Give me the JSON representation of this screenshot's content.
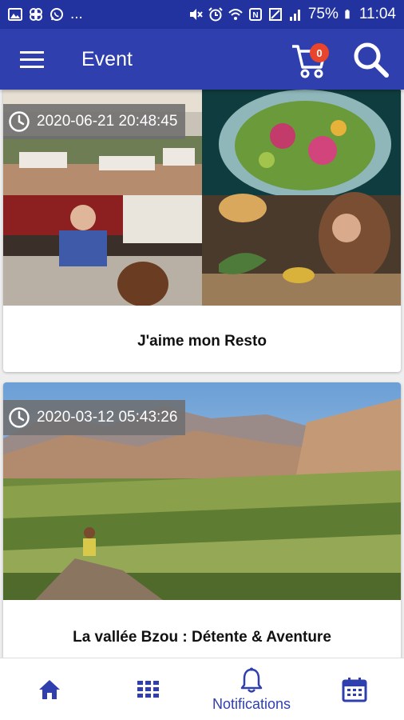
{
  "status_bar": {
    "battery": "75%",
    "time": "11:04",
    "left_icons": [
      "gallery-icon",
      "pinwheel-icon",
      "whatsapp-icon"
    ],
    "ellipsis": "..."
  },
  "app_bar": {
    "title": "Event",
    "cart_count": "0",
    "accent": "#2f3fae"
  },
  "events": [
    {
      "date": "2020-06-21 20:48:45",
      "title": "J'aime mon Resto"
    },
    {
      "date": "2020-03-12 05:43:26",
      "title": "La vallée Bzou : Détente & Aventure"
    }
  ],
  "bottom_nav": {
    "items": [
      {
        "icon": "home-icon"
      },
      {
        "icon": "grid-icon"
      },
      {
        "icon": "bell-icon",
        "label": "Notifications"
      },
      {
        "icon": "calendar-icon"
      }
    ]
  },
  "colors": {
    "primary": "#2f3fae",
    "status_bar": "#2233a0",
    "badge": "#e8452c"
  }
}
